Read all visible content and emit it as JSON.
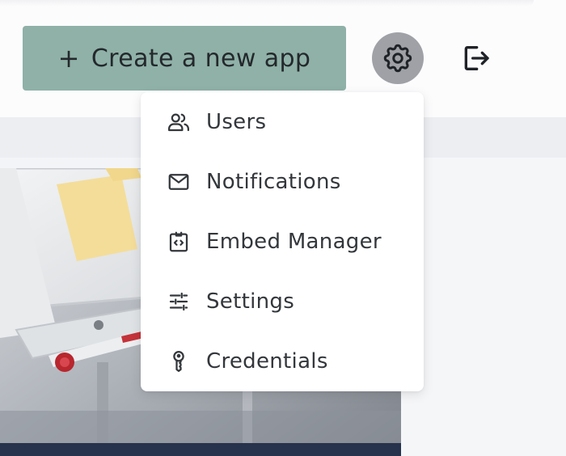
{
  "header": {
    "create_button": {
      "plus": "+",
      "label": "Create a new app"
    },
    "settings_icon": "gear-icon",
    "logout_icon": "logout-icon"
  },
  "menu": {
    "items": [
      {
        "label": "Users",
        "icon": "users-icon"
      },
      {
        "label": "Notifications",
        "icon": "mail-icon"
      },
      {
        "label": "Embed Manager",
        "icon": "embed-icon"
      },
      {
        "label": "Settings",
        "icon": "sliders-icon"
      },
      {
        "label": "Credentials",
        "icon": "key-icon"
      }
    ]
  },
  "colors": {
    "accent": "#8fb1a7",
    "gear_circle": "#9fa1a6",
    "footer": "#27334d",
    "text": "#33373b"
  }
}
